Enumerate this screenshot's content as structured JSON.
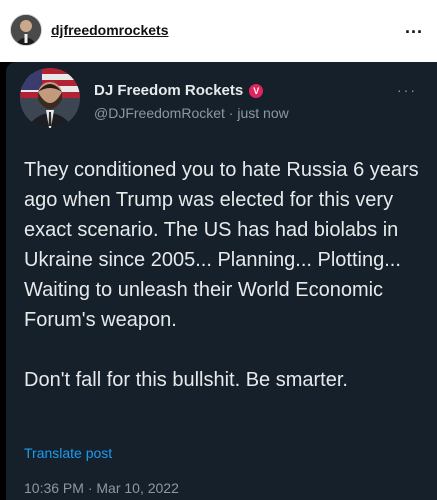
{
  "instagram": {
    "username": "djfreedomrockets",
    "more_icon": "..."
  },
  "tweet": {
    "display_name": "DJ Freedom Rockets",
    "verified_glyph": "V",
    "handle": "@DJFreedomRocket",
    "separator": " · ",
    "time_ago": "just now",
    "more_icon": "···",
    "body_paragraph_1": "They conditioned you to hate Russia 6 years ago when Trump was elected for this very exact scenario. The US has had biolabs in Ukraine since 2005... Planning... Plotting... Waiting to unleash their World Economic Forum's weapon.",
    "body_paragraph_2": "Don't fall for this bullshit. Be smarter.",
    "translate_label": "Translate post",
    "timestamp": "10:36 PM · Mar 10, 2022"
  },
  "colors": {
    "tweet_bg": "#15202b",
    "text": "#e7e9ea",
    "muted": "#8b98a5",
    "link": "#1d9bf0",
    "verified": "#e0245e"
  }
}
